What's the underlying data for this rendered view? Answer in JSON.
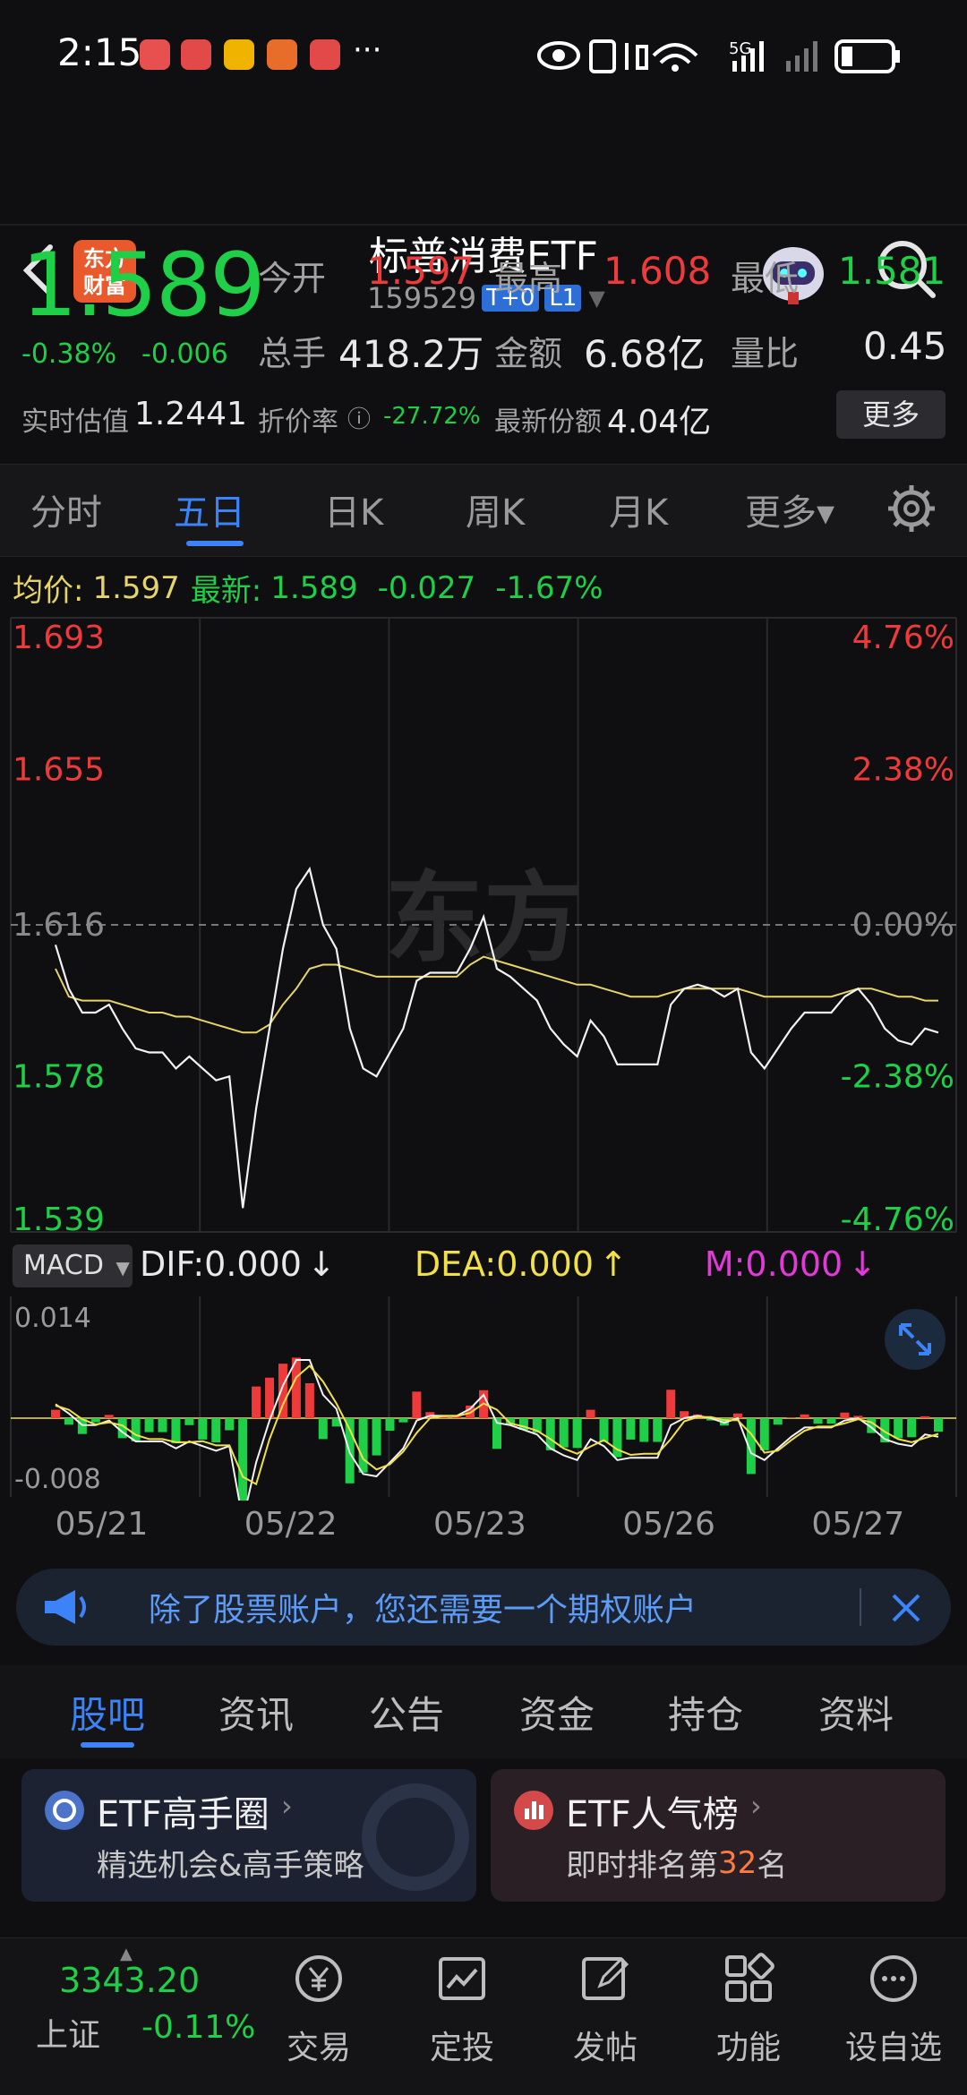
{
  "status_bar": {
    "time": "2:15",
    "network": "5G",
    "more": "···"
  },
  "header": {
    "title": "标普消费ETF",
    "logo_line1": "东方",
    "logo_line2": "财富",
    "code": "159529",
    "tag1": "T+0",
    "tag2": "L1"
  },
  "quote": {
    "price": "1.589",
    "change_pct": "-0.38%",
    "change": "-0.006",
    "open_label": "今开",
    "open": "1.597",
    "high_label": "最高",
    "high": "1.608",
    "low_label": "最低",
    "low": "1.581",
    "volume_label": "总手",
    "volume": "418.2万",
    "amount_label": "金额",
    "amount": "6.68亿",
    "ratio_label": "量比",
    "ratio": "0.45",
    "est_label": "实时估值",
    "est": "1.2441",
    "discount_label": "折价率",
    "discount": "-27.72%",
    "shares_label": "最新份额",
    "shares": "4.04亿",
    "more_label": "更多"
  },
  "chart_tabs": [
    "分时",
    "五日",
    "日K",
    "周K",
    "月K",
    "更多▾"
  ],
  "legend": {
    "avg_label": "均价:",
    "avg": "1.597",
    "latest_label": "最新:",
    "latest": "1.589",
    "diff": "-0.027",
    "diff_pct": "-1.67%"
  },
  "chart_data": {
    "type": "line",
    "title": "",
    "days": [
      "05/21",
      "05/22",
      "05/23",
      "05/26",
      "05/27"
    ],
    "y_ticks_left": [
      "1.693",
      "1.655",
      "1.616",
      "1.578",
      "1.539"
    ],
    "y_ticks_right": [
      "4.76%",
      "2.38%",
      "0.00%",
      "-2.38%",
      "-4.76%"
    ],
    "ylim": [
      1.539,
      1.693
    ],
    "reference": 1.616,
    "series": [
      {
        "values": [
          1.611,
          1.6,
          1.594,
          1.594,
          1.596,
          1.59,
          1.585,
          1.584,
          1.584,
          1.58,
          1.583,
          1.58,
          1.577,
          1.578,
          1.545,
          1.57,
          1.59,
          1.61,
          1.625,
          1.63,
          1.616,
          1.61,
          1.59,
          1.58,
          1.578,
          1.584,
          1.59,
          1.602,
          1.604,
          1.604,
          1.604,
          1.61,
          1.618,
          1.605,
          1.603,
          1.6,
          1.597,
          1.59,
          1.586,
          1.583,
          1.592,
          1.588,
          1.581,
          1.581,
          1.581,
          1.581,
          1.596,
          1.6,
          1.601,
          1.6,
          1.598,
          1.6,
          1.584,
          1.58,
          1.585,
          1.59,
          1.594,
          1.594,
          1.594,
          1.598,
          1.6,
          1.596,
          1.59,
          1.587,
          1.586,
          1.59,
          1.589
        ]
      },
      {
        "values": [
          1.605,
          1.598,
          1.597,
          1.597,
          1.597,
          1.596,
          1.595,
          1.594,
          1.594,
          1.593,
          1.593,
          1.592,
          1.591,
          1.59,
          1.589,
          1.589,
          1.591,
          1.596,
          1.6,
          1.605,
          1.606,
          1.606,
          1.605,
          1.604,
          1.603,
          1.603,
          1.603,
          1.603,
          1.603,
          1.603,
          1.603,
          1.606,
          1.608,
          1.607,
          1.606,
          1.605,
          1.604,
          1.603,
          1.602,
          1.601,
          1.601,
          1.6,
          1.599,
          1.598,
          1.598,
          1.598,
          1.599,
          1.6,
          1.6,
          1.6,
          1.6,
          1.6,
          1.599,
          1.598,
          1.598,
          1.598,
          1.598,
          1.598,
          1.598,
          1.599,
          1.6,
          1.6,
          1.599,
          1.598,
          1.598,
          1.597,
          1.597
        ]
      }
    ]
  },
  "macd": {
    "label": "MACD",
    "dif": "DIF:0.000",
    "dif_arrow": "↓",
    "dea": "DEA:0.000",
    "dea_arrow": "↑",
    "m": "M:0.000",
    "m_arrow": "↓",
    "top": "0.014",
    "bottom": "-0.008"
  },
  "banner": {
    "text": "除了股票账户，您还需要一个期权账户"
  },
  "sub_tabs": [
    "股吧",
    "资讯",
    "公告",
    "资金",
    "持仓",
    "资料"
  ],
  "cards": [
    {
      "title": "ETF高手圈",
      "sub": "精选机会&高手策略"
    },
    {
      "title": "ETF人气榜",
      "sub_pre": "即时排名第",
      "rank": "32",
      "sub_post": "名"
    }
  ],
  "nav": {
    "index_value": "3343.20",
    "index_name": "上证",
    "index_change": "-0.11%",
    "items": [
      "交易",
      "定投",
      "发帖",
      "功能",
      "设自选"
    ]
  },
  "colors": {
    "up": "#ee3a3a",
    "down": "#1ecf47",
    "accent": "#3b83f6",
    "avg_line": "#e6d46a"
  }
}
